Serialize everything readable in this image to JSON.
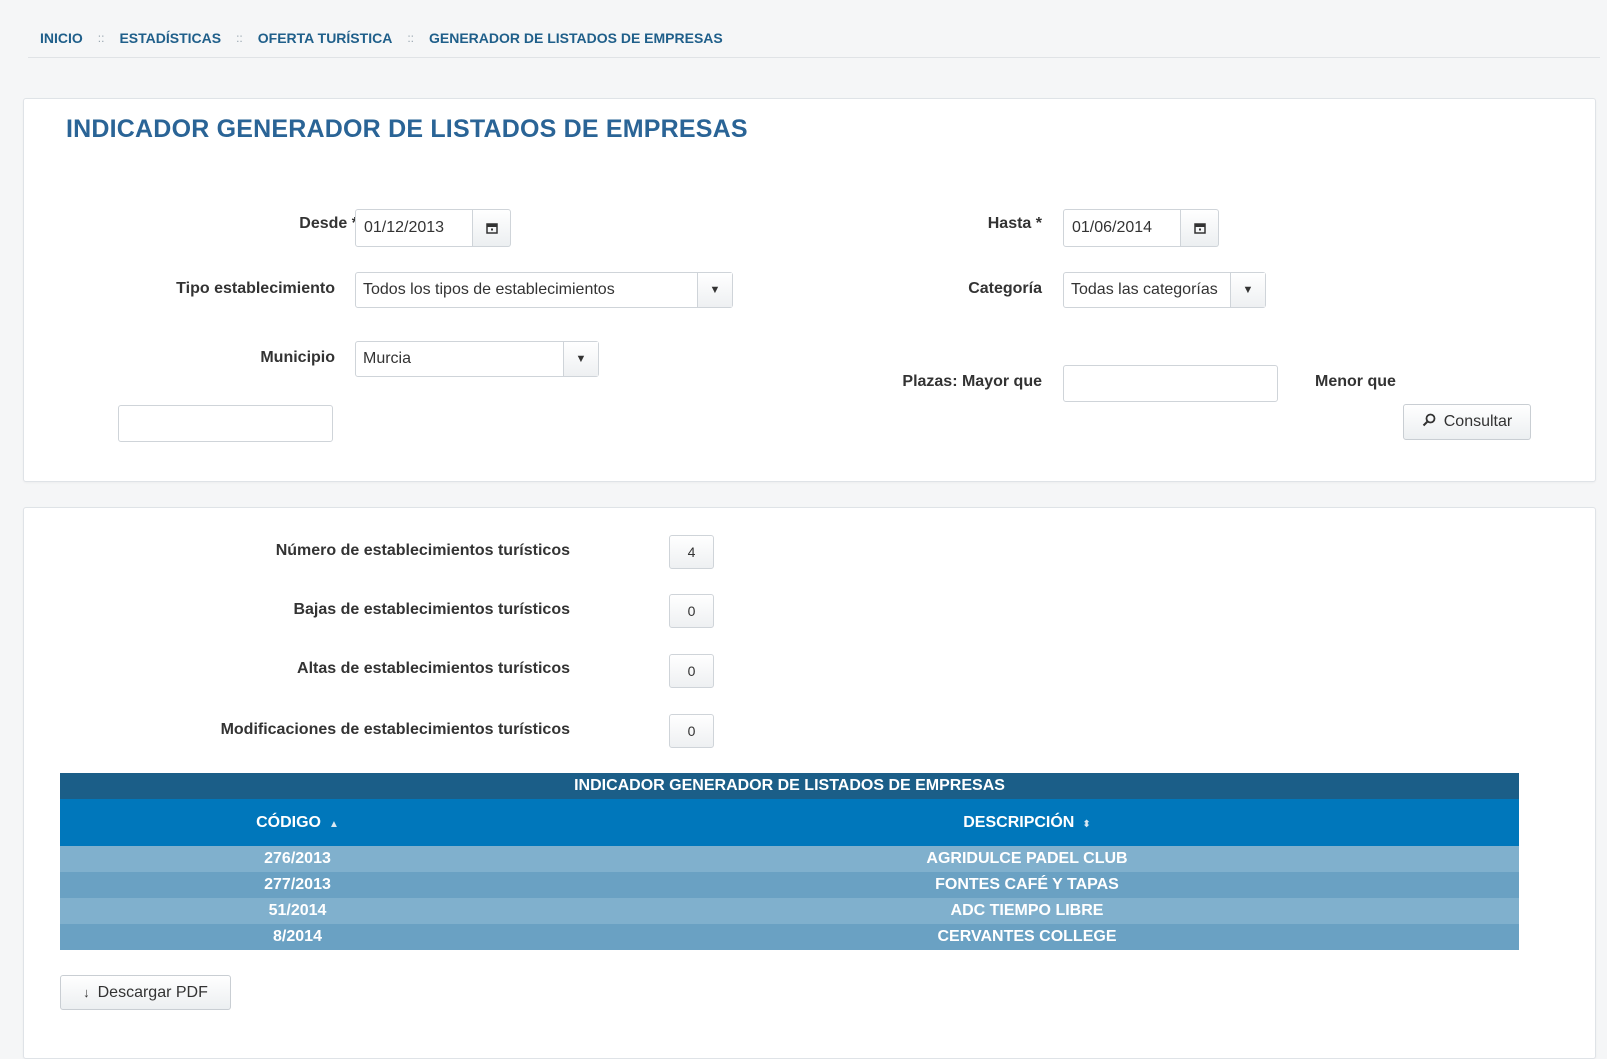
{
  "breadcrumb": {
    "items": [
      "INICIO",
      "ESTADÍSTICAS",
      "OFERTA TURÍSTICA",
      "GENERADOR DE LISTADOS DE EMPRESAS"
    ],
    "separator": "::"
  },
  "form": {
    "title": "INDICADOR GENERADOR DE LISTADOS DE EMPRESAS",
    "desde_label": "Desde *",
    "desde_value": "01/12/2013",
    "hasta_label": "Hasta *",
    "hasta_value": "01/06/2014",
    "tipo_label": "Tipo establecimiento",
    "tipo_value": "Todos los tipos de establecimientos",
    "categoria_label": "Categoría",
    "categoria_value": "Todas las categorías",
    "municipio_label": "Municipio",
    "municipio_value": "Murcia",
    "plazas_mayor_label": "Plazas: Mayor que",
    "plazas_mayor_value": "",
    "plazas_menor_label": "Menor que",
    "plazas_menor_value": "",
    "consultar_label": "Consultar"
  },
  "results": {
    "stats": [
      {
        "label": "Número de establecimientos turísticos",
        "value": "4"
      },
      {
        "label": "Bajas de establecimientos turísticos",
        "value": "0"
      },
      {
        "label": "Altas de establecimientos turísticos",
        "value": "0"
      },
      {
        "label": "Modificaciones de establecimientos turísticos",
        "value": "0"
      }
    ],
    "table": {
      "caption": "INDICADOR GENERADOR DE LISTADOS DE EMPRESAS",
      "columns": [
        "CÓDIGO",
        "DESCRIPCIÓN"
      ],
      "rows": [
        [
          "276/2013",
          "AGRIDULCE PADEL CLUB"
        ],
        [
          "277/2013",
          "FONTES CAFÉ Y TAPAS"
        ],
        [
          "51/2014",
          "ADC TIEMPO LIBRE"
        ],
        [
          "8/2014",
          "CERVANTES COLLEGE"
        ]
      ]
    },
    "download_label": "Descargar PDF"
  },
  "icons": {
    "calendar": "calendar-icon",
    "caret": "caret-down-icon",
    "search": "search-icon",
    "download": "download-icon",
    "sort_asc": "sort-asc-icon",
    "sort_both": "sort-both-icon"
  },
  "colors": {
    "accent": "#2a6496",
    "table_caption": "#1b5e88",
    "table_header": "#0077bb",
    "row_odd": "#80b0cd",
    "row_even": "#6aa1c3"
  }
}
